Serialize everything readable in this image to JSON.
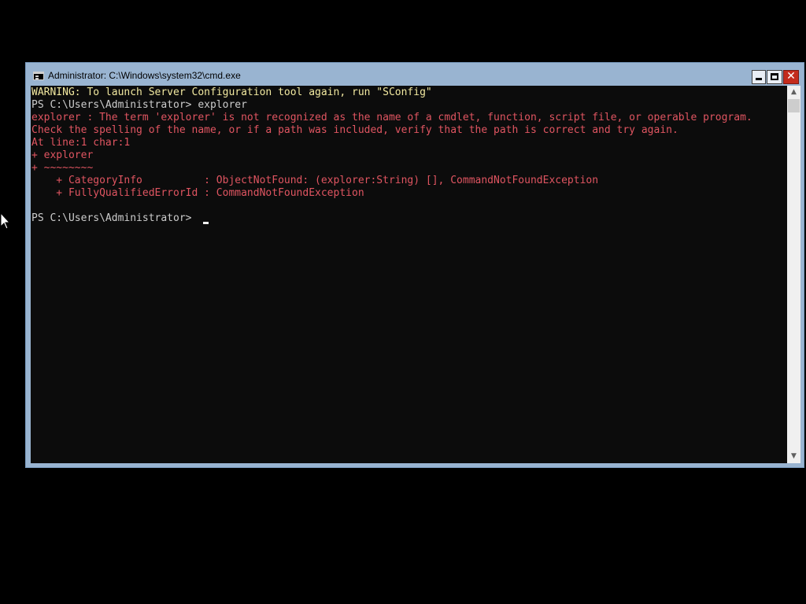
{
  "window": {
    "title": "Administrator: C:\\Windows\\system32\\cmd.exe",
    "minimize_icon": "minimize-icon",
    "maximize_icon": "maximize-icon",
    "close_icon": "close-icon",
    "close_glyph": "✕"
  },
  "console": {
    "lines": [
      {
        "text": "WARNING: To launch Server Configuration tool again, run \"SConfig\"",
        "kind": "warning"
      },
      {
        "text": "PS C:\\Users\\Administrator> explorer",
        "kind": "normal"
      },
      {
        "text": "explorer : The term 'explorer' is not recognized as the name of a cmdlet, function, script file, or operable program.",
        "kind": "error"
      },
      {
        "text": "Check the spelling of the name, or if a path was included, verify that the path is correct and try again.",
        "kind": "error"
      },
      {
        "text": "At line:1 char:1",
        "kind": "error"
      },
      {
        "text": "+ explorer",
        "kind": "error"
      },
      {
        "text": "+ ~~~~~~~~",
        "kind": "error"
      },
      {
        "text": "    + CategoryInfo          : ObjectNotFound: (explorer:String) [], CommandNotFoundException",
        "kind": "error"
      },
      {
        "text": "    + FullyQualifiedErrorId : CommandNotFoundException",
        "kind": "error"
      },
      {
        "text": "",
        "kind": "normal"
      },
      {
        "text": "PS C:\\Users\\Administrator> ",
        "kind": "normal"
      }
    ]
  },
  "scrollbar": {
    "up_glyph": "▲",
    "down_glyph": "▼",
    "up_icon": "scroll-up-arrow-icon",
    "down_icon": "scroll-down-arrow-icon"
  },
  "colors": {
    "warning": "#f2e9a0",
    "normal": "#cccccc",
    "error": "#e05561",
    "console_background": "#0c0c0c",
    "titlebar": "#99b4d1"
  }
}
